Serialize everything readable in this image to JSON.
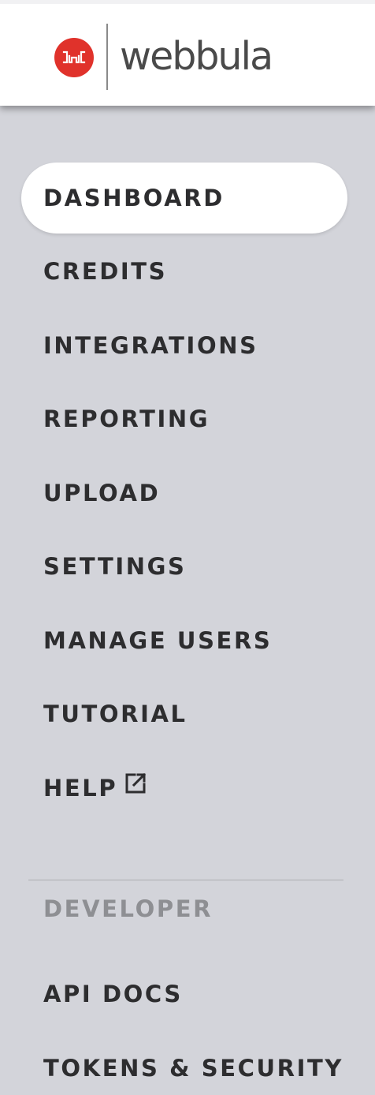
{
  "brand": {
    "name": "webbula",
    "accent_color": "#e0322b",
    "logo_icon": "webbula-logo-icon"
  },
  "nav": {
    "active": "DASHBOARD",
    "items": [
      {
        "label": "DASHBOARD",
        "active": true
      },
      {
        "label": "CREDITS"
      },
      {
        "label": "INTEGRATIONS"
      },
      {
        "label": "REPORTING"
      },
      {
        "label": "UPLOAD"
      },
      {
        "label": "SETTINGS"
      },
      {
        "label": "MANAGE USERS"
      },
      {
        "label": "TUTORIAL"
      },
      {
        "label": "HELP",
        "icon": "external-link-icon"
      }
    ]
  },
  "developer": {
    "section_label": "DEVELOPER",
    "items": [
      {
        "label": "API DOCS"
      },
      {
        "label": "TOKENS & SECURITY"
      }
    ]
  }
}
